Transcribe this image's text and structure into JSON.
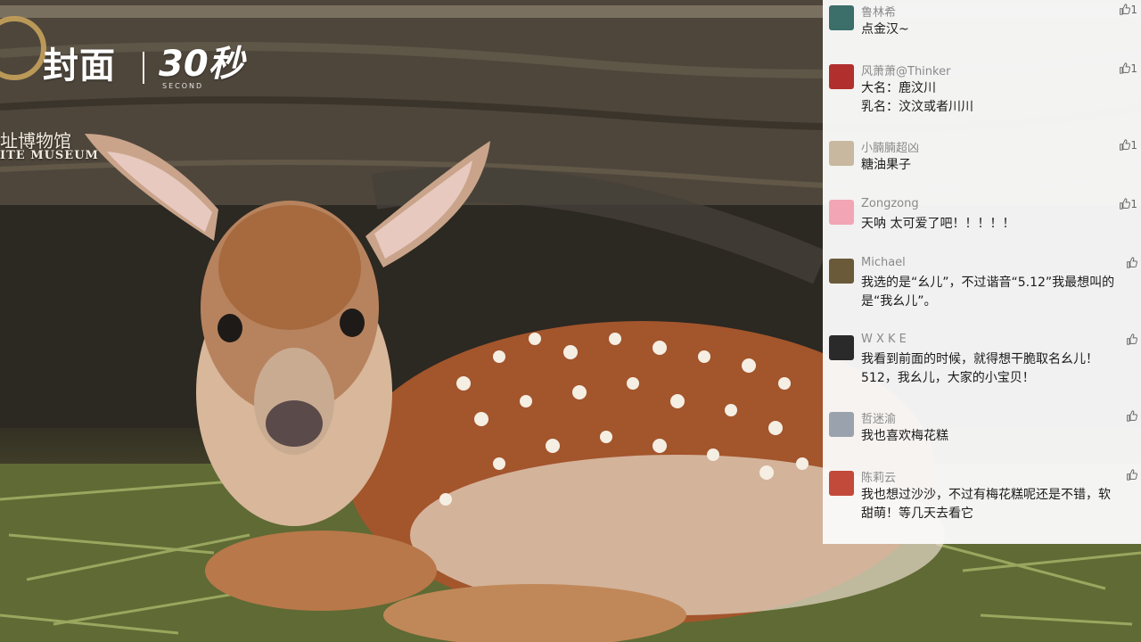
{
  "branding": {
    "logo_main": "封面",
    "logo_sub": "30秒",
    "logo_sub_small": "SECOND",
    "museum_cn": "址博物馆",
    "museum_en": "ITE MUSEUM"
  },
  "comments": [
    {
      "name": "鲁林希",
      "lines": [
        "点金汉~"
      ],
      "like": "1",
      "avatar_color": "#3c6e6a"
    },
    {
      "name": "风萧萧@Thinker",
      "lines": [
        "大名：鹿汶川",
        "乳名：汶汶或者川川"
      ],
      "like": "1",
      "avatar_color": "#b1302e"
    },
    {
      "name": "小腩腩超凶",
      "lines": [
        "糖油果子"
      ],
      "like": "1",
      "avatar_color": "#c9b8a0"
    },
    {
      "name": "Zongzong",
      "lines": [
        "天呐 太可爱了吧！！！！！"
      ],
      "like": "1",
      "avatar_color": "#f2a6b5"
    },
    {
      "name": "Michael",
      "lines": [
        "我选的是“幺儿”，不过谐音“5.12”我最想叫的",
        "是“我幺儿”。"
      ],
      "like": "",
      "avatar_color": "#6b5a3a"
    },
    {
      "name": "W X K E",
      "lines": [
        "我看到前面的时候，就得想干脆取名幺儿！",
        "512，我幺儿，大家的小宝贝！"
      ],
      "like": "",
      "avatar_color": "#2a2a2a"
    },
    {
      "name": "哲迷渝",
      "lines": [
        "我也喜欢梅花糕"
      ],
      "like": "",
      "avatar_color": "#9aa3ad"
    },
    {
      "name": "陈莉云",
      "lines": [
        "我也想过沙沙，不过有梅花糕呢还是不错，软",
        "甜萌！等几天去看它"
      ],
      "like": "",
      "avatar_color": "#c24a3a"
    }
  ]
}
